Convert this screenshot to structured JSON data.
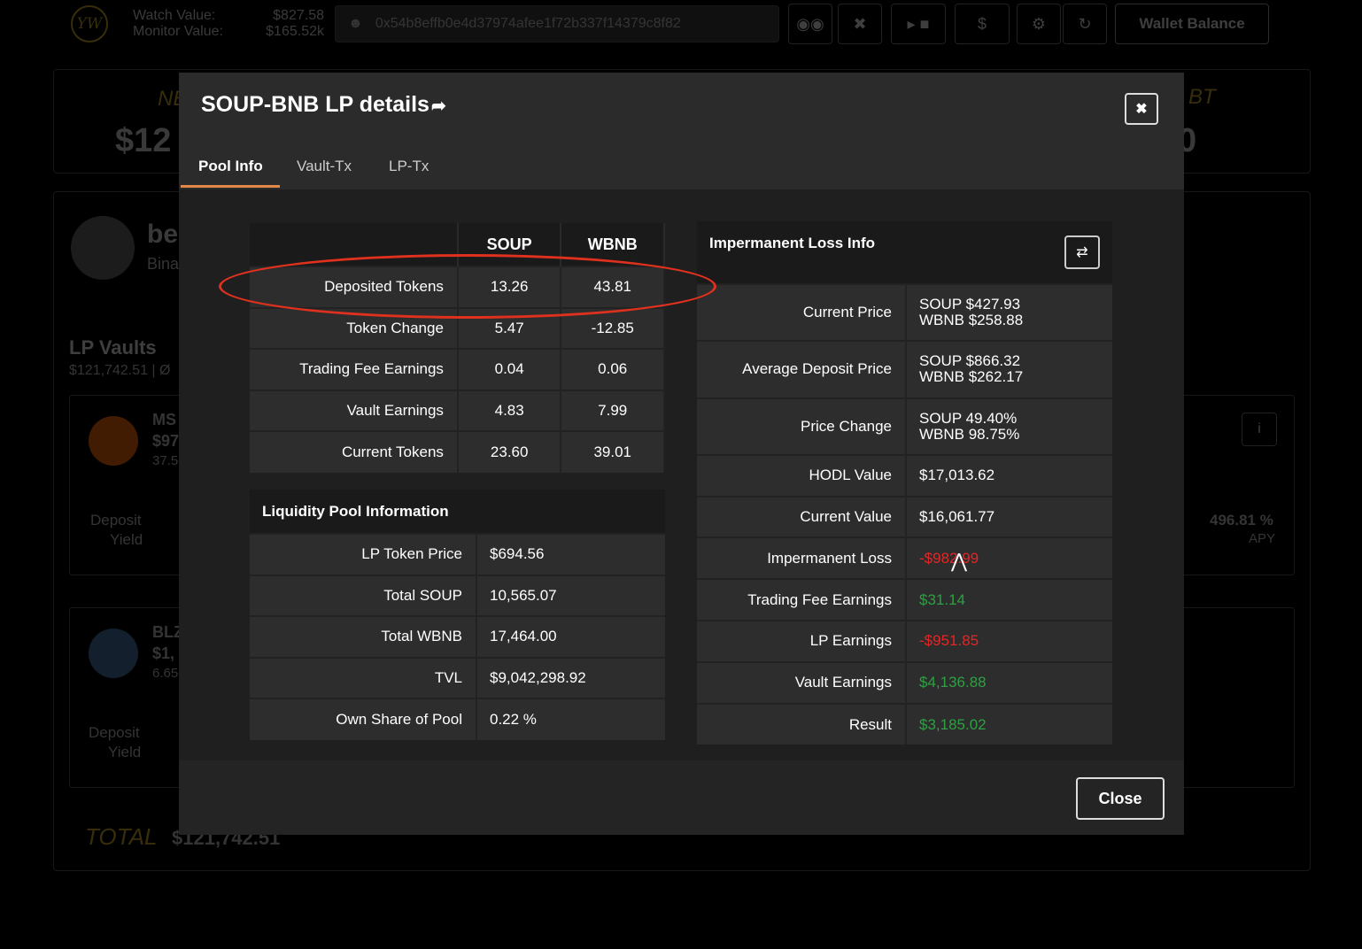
{
  "header": {
    "logo_text": "YW",
    "watch_label": "Watch Value:",
    "watch_value": "$827.58",
    "monitor_label": "Monitor Value:",
    "monitor_value": "$165.52k",
    "address": "0x54b8effb0e4d37974afee1f72b337f14379c8f82",
    "currency_symbol": "$",
    "wallet_balance_label": "Wallet Balance"
  },
  "background": {
    "net_fragment": "$12",
    "left_fragment_top": "NE",
    "right_fragment_top": "BT",
    "right_fragment_value": "0",
    "be_fragment": "be",
    "bina_fragment": "Bina",
    "lp_vaults_label": "LP Vaults",
    "lp_vaults_sub": "$121,742.51 | Ø",
    "vault1_name": "MS",
    "vault1_value": "$97",
    "vault1_sub": "37.5",
    "vault2_name": "BLZ",
    "vault2_value": "$1,",
    "vault2_sub": "6.65",
    "deposit_label": "Deposit",
    "yield_label": "Yield",
    "apy_value": "496.81 %",
    "apy_label": "APY",
    "info_icon_text": "i",
    "total_label": "TOTAL",
    "total_value": "$121,742.51"
  },
  "modal": {
    "title": "SOUP-BNB LP details",
    "tabs": [
      "Pool Info",
      "Vault-Tx",
      "LP-Tx"
    ],
    "close_label": "Close",
    "token_table": {
      "columns": [
        "SOUP",
        "WBNB"
      ],
      "rows": [
        {
          "label": "Deposited Tokens",
          "soup": "13.26",
          "wbnb": "43.81"
        },
        {
          "label": "Token Change",
          "soup": "5.47",
          "wbnb": "-12.85"
        },
        {
          "label": "Trading Fee Earnings",
          "soup": "0.04",
          "wbnb": "0.06"
        },
        {
          "label": "Vault Earnings",
          "soup": "4.83",
          "wbnb": "7.99"
        },
        {
          "label": "Current Tokens",
          "soup": "23.60",
          "wbnb": "39.01"
        }
      ]
    },
    "lp_info": {
      "title": "Liquidity Pool Information",
      "rows": [
        {
          "label": "LP Token Price",
          "value": "$694.56"
        },
        {
          "label": "Total SOUP",
          "value": "10,565.07"
        },
        {
          "label": "Total WBNB",
          "value": "17,464.00"
        },
        {
          "label": "TVL",
          "value": "$9,042,298.92"
        },
        {
          "label": "Own Share of Pool",
          "value": "0.22 %"
        }
      ]
    },
    "il_info": {
      "title": "Impermanent Loss Info",
      "rows": [
        {
          "label": "Current Price",
          "line1": "SOUP $427.93",
          "line2": "WBNB $258.88"
        },
        {
          "label": "Average Deposit Price",
          "line1": "SOUP $866.32",
          "line2": "WBNB $262.17"
        },
        {
          "label": "Price Change",
          "line1": "SOUP 49.40%",
          "line2": "WBNB 98.75%"
        },
        {
          "label": "HODL Value",
          "value": "$17,013.62"
        },
        {
          "label": "Current Value",
          "value": "$16,061.77"
        },
        {
          "label": "Impermanent Loss",
          "value": "-$982.99"
        },
        {
          "label": "Trading Fee Earnings",
          "value": "$31.14"
        },
        {
          "label": "LP Earnings",
          "value": "-$951.85"
        },
        {
          "label": "Vault Earnings",
          "value": "$4,136.88"
        },
        {
          "label": "Result",
          "value": "$3,185.02"
        }
      ]
    }
  },
  "colors": {
    "accent": "#e2894a",
    "negative": "#e32626",
    "positive": "#2ea043",
    "highlight_circle": "#e0301e"
  }
}
